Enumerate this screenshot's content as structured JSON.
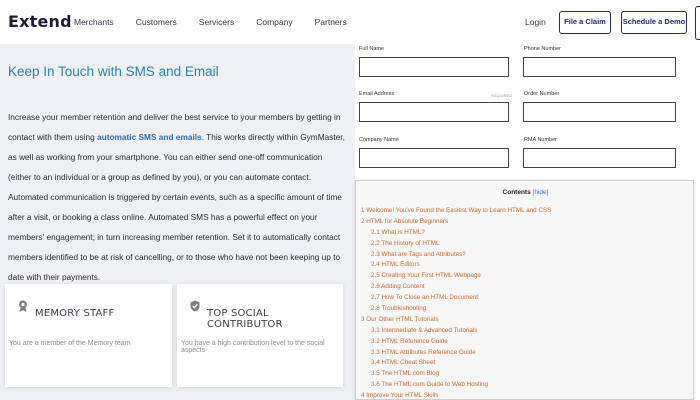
{
  "brand": {
    "logo": "Extend",
    "accent": "#1f2a6b",
    "link_color": "#2a7fc1"
  },
  "nav": {
    "links": [
      "Merchants",
      "Customers",
      "Servicers",
      "Company",
      "Partners"
    ],
    "login": "Login",
    "file_claim": "File a Claim",
    "schedule_demo": "Schedule a Demo"
  },
  "content": {
    "title": "Keep In Touch with SMS and Email",
    "body_before": "Increase your member retention and deliver the best service to your members by getting in contact with them using ",
    "body_link": "automatic SMS and emails",
    "body_after": ". This works directly within GymMaster, as well as working from your smartphone. You can either send one-off communication (either to an individual or a group as defined by you), or you can automate contact. Automated communication is triggered by certain events, such as a specific amount of time after a visit, or booking a class online. Automated SMS has a powerful effect on your members' engagement; in turn increasing member retention. Set it to automatically contact members identified to be at risk of cancelling, or to those who have not been keeping up to date with their payments."
  },
  "cards": [
    {
      "icon": "badge-icon",
      "title": "MEMORY STAFF",
      "desc": "You are a member of the Memory team"
    },
    {
      "icon": "checkmark-shield-icon",
      "title": "TOP SOCIAL CONTRIBUTOR",
      "desc": "You have a high contribution level to the social aspects"
    }
  ],
  "form": {
    "full_name": "Full Name",
    "phone": "Phone Number",
    "email": "Email Address",
    "email_note": "REQUIRED",
    "order": "Order Number",
    "company": "Company Name",
    "rma": "RMA Number"
  },
  "toc": {
    "title": "Contents",
    "hide": "[hide]",
    "items": [
      {
        "text": "1 Welcome! You've Found the Easiest Way to Learn HTML and CSS",
        "level": 1
      },
      {
        "text": "2 HTML for Absolute Beginners",
        "level": 1
      },
      {
        "text": "2.1 What is HTML?",
        "level": 2
      },
      {
        "text": "2.2 The History of HTML",
        "level": 2
      },
      {
        "text": "2.3 What are Tags and Attributes?",
        "level": 2
      },
      {
        "text": "2.4 HTML Editors",
        "level": 2
      },
      {
        "text": "2.5 Creating Your First HTML Webpage",
        "level": 2
      },
      {
        "text": "2.6 Adding Content",
        "level": 2
      },
      {
        "text": "2.7 How To Close an HTML Document",
        "level": 2
      },
      {
        "text": "2.8 Troubleshooting",
        "level": 2
      },
      {
        "text": "3 Our Other HTML Tutorials",
        "level": 1
      },
      {
        "text": "3.1 Intermediate & Advanced Tutorials",
        "level": 2
      },
      {
        "text": "3.2 HTML Reference Guide",
        "level": 2
      },
      {
        "text": "3.3 HTML Attributes Reference Guide",
        "level": 2
      },
      {
        "text": "3.4 HTML Cheat Sheet",
        "level": 2
      },
      {
        "text": "3.5 The HTML.com Blog",
        "level": 2
      },
      {
        "text": "3.6 The HTML.com Guide to Web Hosting",
        "level": 2
      },
      {
        "text": "4 Improve Your HTML Skills",
        "level": 1
      }
    ]
  }
}
